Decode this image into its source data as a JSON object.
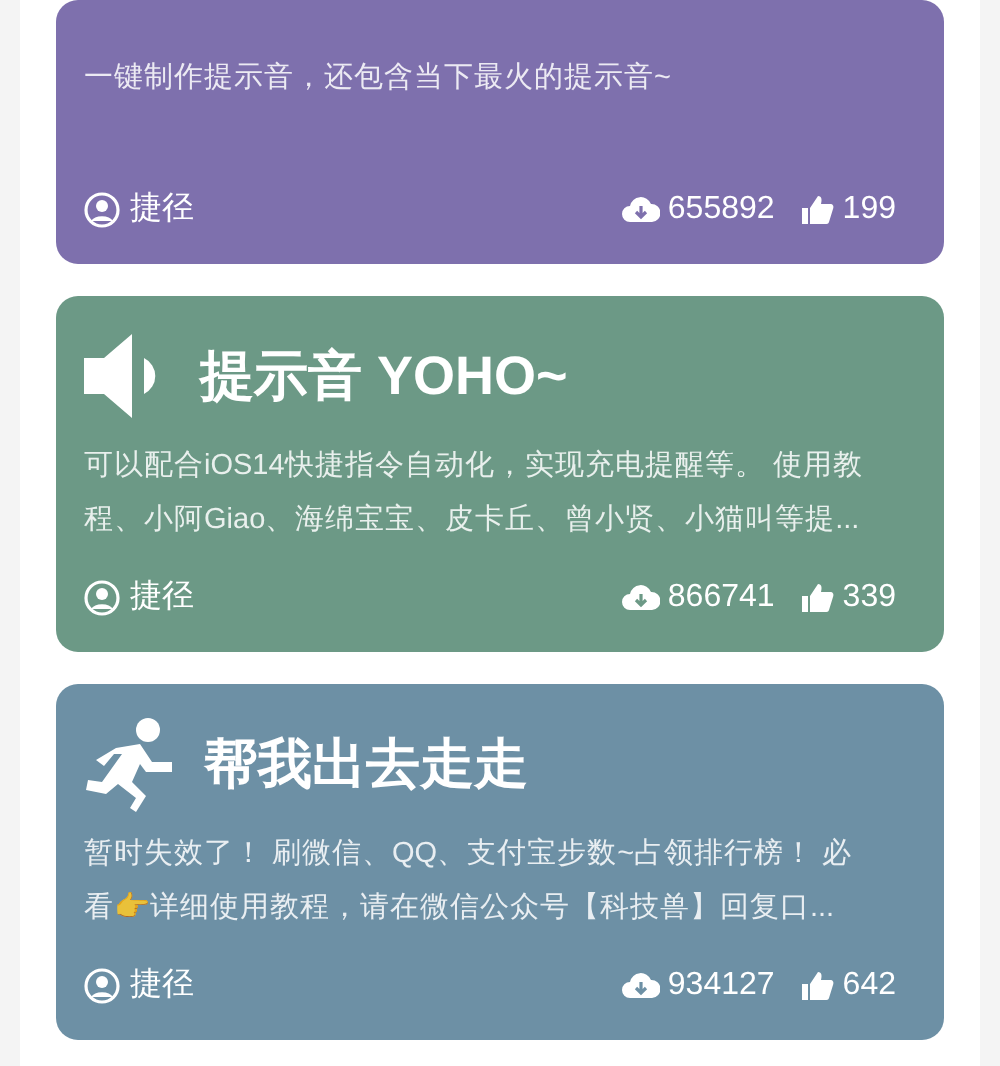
{
  "cards": [
    {
      "color": "#7e70ad",
      "description_lines": [
        "一键制作提示音，还包含当下最火的提示音~"
      ],
      "author": "捷径",
      "downloads": "655892",
      "likes": "199"
    },
    {
      "kind": "speaker",
      "color": "#6c9986",
      "title": "提示音 YOHO~",
      "description_lines": [
        "可以配合iOS14快捷指令自动化，实现充电提醒等。 使用教",
        "程、小阿Giao、海绵宝宝、皮卡丘、曾小贤、小猫叫等提..."
      ],
      "author": "捷径",
      "downloads": "866741",
      "likes": "339"
    },
    {
      "kind": "runner",
      "color": "#6d90a5",
      "title": "帮我出去走走",
      "description_lines": [
        "暂时失效了！ 刷微信、QQ、支付宝步数~占领排行榜！ 必",
        "看👉详细使用教程，请在微信公众号【科技兽】回复口..."
      ],
      "author": "捷径",
      "downloads": "934127",
      "likes": "642"
    }
  ]
}
